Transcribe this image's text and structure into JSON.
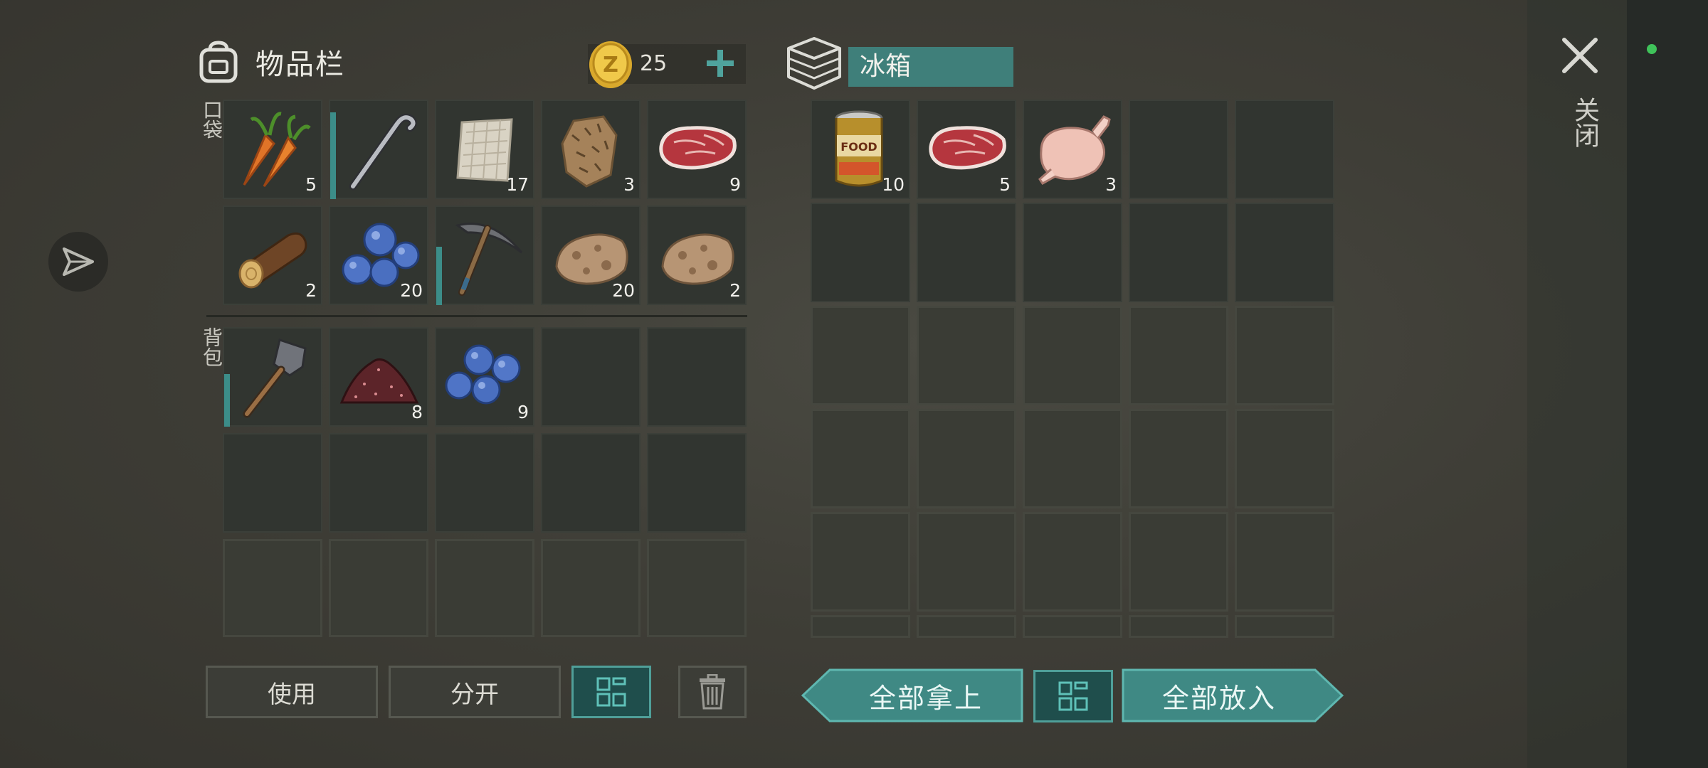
{
  "inventory": {
    "title": "物品栏",
    "currency_count": "25",
    "pocket_label": "口袋",
    "backpack_label": "背包",
    "pocket_items": [
      {
        "name": "carrot",
        "qty": "5"
      },
      {
        "name": "crowbar",
        "qty": ""
      },
      {
        "name": "cloth",
        "qty": "17"
      },
      {
        "name": "fur",
        "qty": "3"
      },
      {
        "name": "raw-steak",
        "qty": "9"
      },
      {
        "name": "log",
        "qty": "2"
      },
      {
        "name": "blueberries",
        "qty": "20"
      },
      {
        "name": "pickaxe",
        "qty": ""
      },
      {
        "name": "stone",
        "qty": "20"
      },
      {
        "name": "stone",
        "qty": "2"
      }
    ],
    "backpack_items": [
      {
        "name": "shovel",
        "qty": ""
      },
      {
        "name": "soil-pile",
        "qty": "8"
      },
      {
        "name": "blueberries",
        "qty": "9"
      }
    ]
  },
  "container": {
    "name": "冰箱",
    "items": [
      {
        "name": "canned-food",
        "qty": "10"
      },
      {
        "name": "raw-steak",
        "qty": "5"
      },
      {
        "name": "raw-chicken",
        "qty": "3"
      }
    ]
  },
  "buttons": {
    "use": "使用",
    "split": "分开",
    "take_all": "全部拿上",
    "put_all": "全部放入"
  },
  "close_label": "关闭",
  "colors": {
    "accent": "#3f7f7a",
    "accent_border": "#4f9f99",
    "coin": "#e0b53a",
    "status": "#3fc35a"
  },
  "icons": [
    "backpack-icon",
    "coin-icon",
    "plus-icon",
    "box-icon",
    "close-icon",
    "send-icon",
    "sort-grid-icon",
    "trash-icon"
  ]
}
